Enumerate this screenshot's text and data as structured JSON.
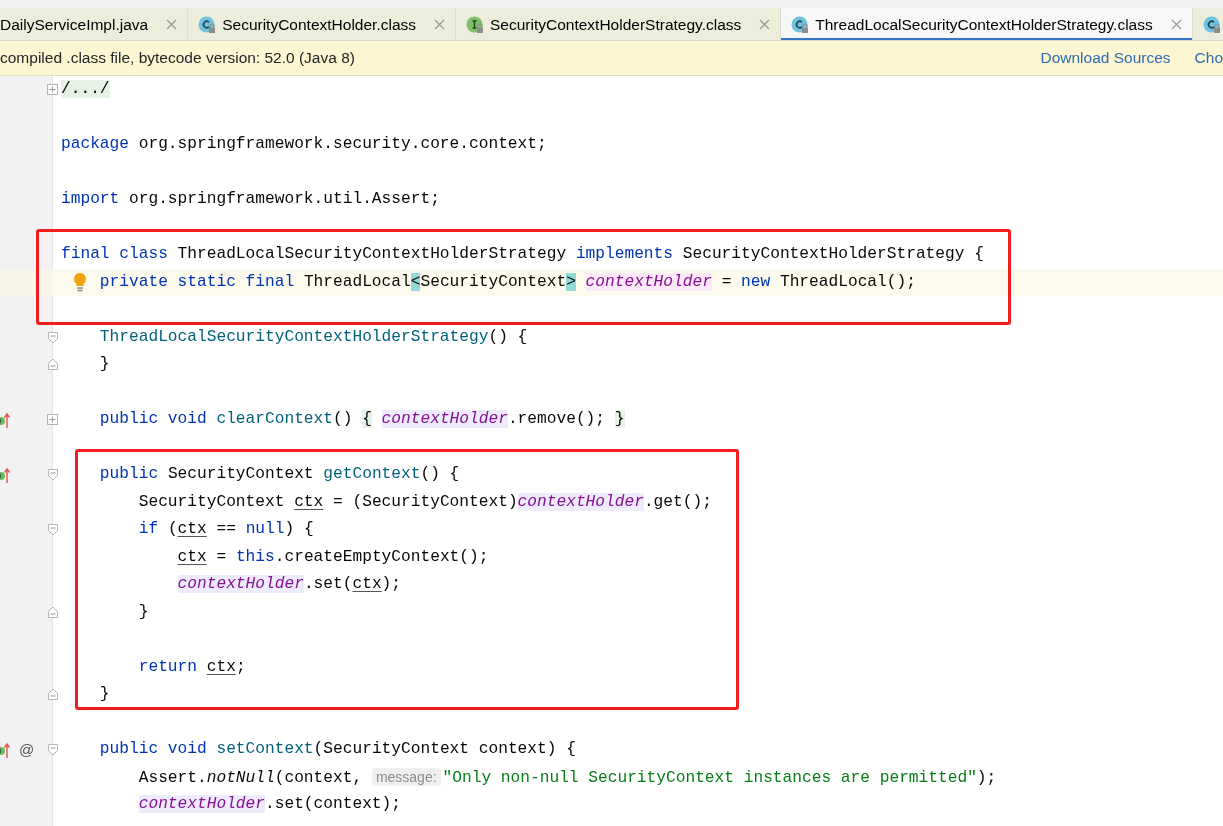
{
  "tabs": [
    {
      "label": "DailyServiceImpl.java",
      "selected": false
    },
    {
      "label": "SecurityContextHolder.class",
      "icon": {
        "kind": "class"
      },
      "selected": false
    },
    {
      "label": "SecurityContextHolderStrategy.class",
      "icon": {
        "kind": "interface"
      },
      "selected": false
    },
    {
      "label": "ThreadLocalSecurityContextHolderStrategy.class",
      "icon": {
        "kind": "class"
      },
      "selected": true
    },
    {
      "icon": {
        "kind": "class"
      },
      "selected": false
    }
  ],
  "banner": {
    "text": "compiled .class file, bytecode version: 52.0 (Java 8)",
    "links": [
      "Download Sources",
      "Cho"
    ]
  },
  "code": {
    "blocks": [
      {
        "kind": "plain",
        "lines": [
          {
            "fold": {
              "kind": "collapsed"
            },
            "blank_after": true,
            "tokens": [
              {
                "kind": "folded",
                "text": "/.../"
              }
            ]
          },
          {
            "blank_after": true,
            "tokens": [
              {
                "kind": "kw",
                "text": "package"
              },
              {
                "kind": "plain",
                "text": " org.springframework.security.core.context;"
              }
            ]
          },
          {
            "blank_after": true,
            "tokens": [
              {
                "kind": "kw",
                "text": "import"
              },
              {
                "kind": "plain",
                "text": " org.springframework.util.Assert;"
              }
            ]
          }
        ]
      },
      {
        "kind": "framed",
        "lines": [
          {
            "tokens": [
              {
                "kind": "kw",
                "text": "final class"
              },
              {
                "kind": "plain",
                "text": " ThreadLocalSecurityContextHolderStrategy "
              },
              {
                "kind": "kw",
                "text": "implements"
              },
              {
                "kind": "plain",
                "text": " SecurityContextHolderStrategy {"
              }
            ]
          },
          {
            "current": true,
            "bulb": true,
            "blank_after": true,
            "tokens": [
              {
                "kind": "kw",
                "text": "    private static final"
              },
              {
                "kind": "plain",
                "text": " ThreadLocal"
              },
              {
                "kind": "match",
                "text": "<"
              },
              {
                "kind": "plain",
                "text": "SecurityContext"
              },
              {
                "kind": "match",
                "text": ">"
              },
              {
                "kind": "field-decl",
                "text": " contextHolder"
              },
              {
                "kind": "plain",
                "text": " = "
              },
              {
                "kind": "kw",
                "text": "new"
              },
              {
                "kind": "plain",
                "text": " ThreadLocal();"
              }
            ]
          }
        ]
      },
      {
        "kind": "plain",
        "lines": [
          {
            "fold": {
              "kind": "start"
            },
            "tokens": [
              {
                "kind": "method",
                "text": "    ThreadLocalSecurityContextHolderStrategy"
              },
              {
                "kind": "plain",
                "text": "() {"
              }
            ]
          },
          {
            "fold": {
              "kind": "end"
            },
            "blank_after": true,
            "tokens": [
              {
                "kind": "plain",
                "text": "    }"
              }
            ]
          },
          {
            "gutter_icon": {
              "kind": "implements"
            },
            "fold": {
              "kind": "collapsed"
            },
            "blank_after": true,
            "tokens": [
              {
                "kind": "kw",
                "text": "    public void"
              },
              {
                "kind": "method",
                "text": " clearContext"
              },
              {
                "kind": "plain",
                "text": "() "
              },
              {
                "kind": "folded",
                "text": "{"
              },
              {
                "kind": "field",
                "text": " contextHolder"
              },
              {
                "kind": "plain",
                "text": ".remove(); "
              },
              {
                "kind": "folded",
                "text": "}"
              }
            ]
          }
        ]
      },
      {
        "kind": "framed",
        "lines": [
          {
            "gutter_icon": {
              "kind": "implements"
            },
            "fold": {
              "kind": "start"
            },
            "tokens": [
              {
                "kind": "kw",
                "text": "    public"
              },
              {
                "kind": "plain",
                "text": " SecurityContext "
              },
              {
                "kind": "method",
                "text": "getContext"
              },
              {
                "kind": "plain",
                "text": "() {"
              }
            ]
          },
          {
            "tokens": [
              {
                "kind": "plain",
                "text": "        SecurityContext "
              },
              {
                "kind": "var",
                "text": "ctx"
              },
              {
                "kind": "plain",
                "text": " = (SecurityContext)"
              },
              {
                "kind": "field",
                "text": "contextHolder"
              },
              {
                "kind": "plain",
                "text": ".get();"
              }
            ]
          },
          {
            "fold": {
              "kind": "start"
            },
            "tokens": [
              {
                "kind": "kw",
                "text": "        if"
              },
              {
                "kind": "plain",
                "text": " ("
              },
              {
                "kind": "var",
                "text": "ctx"
              },
              {
                "kind": "plain",
                "text": " == "
              },
              {
                "kind": "kw",
                "text": "null"
              },
              {
                "kind": "plain",
                "text": ") {"
              }
            ]
          },
          {
            "tokens": [
              {
                "kind": "var",
                "text": "            ctx"
              },
              {
                "kind": "plain",
                "text": " = "
              },
              {
                "kind": "kw",
                "text": "this"
              },
              {
                "kind": "plain",
                "text": ".createEmptyContext();"
              }
            ]
          },
          {
            "tokens": [
              {
                "kind": "field",
                "text": "            contextHolder"
              },
              {
                "kind": "plain",
                "text": ".set("
              },
              {
                "kind": "var",
                "text": "ctx"
              },
              {
                "kind": "plain",
                "text": ");"
              }
            ]
          },
          {
            "fold": {
              "kind": "end"
            },
            "blank_after": true,
            "tokens": [
              {
                "kind": "plain",
                "text": "        }"
              }
            ]
          },
          {
            "tokens": [
              {
                "kind": "kw",
                "text": "        return"
              },
              {
                "kind": "var",
                "text": " ctx"
              },
              {
                "kind": "plain",
                "text": ";"
              }
            ]
          },
          {
            "fold": {
              "kind": "end"
            },
            "tokens": [
              {
                "kind": "plain",
                "text": "    }"
              }
            ]
          }
        ]
      },
      {
        "kind": "plain",
        "lines": [
          {
            "blank_before": true,
            "gutter_icon": {
              "kind": "implements"
            },
            "gutter_text": "@",
            "fold": {
              "kind": "start"
            },
            "tokens": [
              {
                "kind": "kw",
                "text": "    public void"
              },
              {
                "kind": "method",
                "text": " setContext"
              },
              {
                "kind": "plain",
                "text": "(SecurityContext context) {"
              }
            ]
          },
          {
            "tokens": [
              {
                "kind": "plain",
                "text": "        Assert."
              },
              {
                "kind": "static",
                "text": "notNull"
              },
              {
                "kind": "plain",
                "text": "(context, "
              },
              {
                "kind": "hint",
                "text": "message:"
              },
              {
                "kind": "string",
                "text": "\"Only non-null SecurityContext instances are permitted\""
              },
              {
                "kind": "plain",
                "text": ");"
              }
            ]
          },
          {
            "tokens": [
              {
                "kind": "field",
                "text": "        contextHolder"
              },
              {
                "kind": "plain",
                "text": ".set(context);"
              }
            ]
          }
        ]
      }
    ]
  }
}
